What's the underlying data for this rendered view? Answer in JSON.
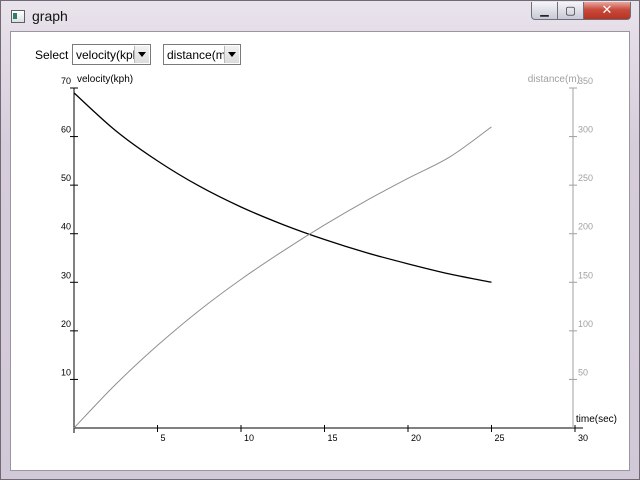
{
  "window": {
    "title": "graph"
  },
  "controls": {
    "select_label": "Select",
    "y_axis_select": {
      "value": "velocity(kph)"
    },
    "y2_axis_select": {
      "value": "distance(m)"
    }
  },
  "colors": {
    "velocity_line": "#000000",
    "distance_line": "#8f8f8f",
    "right_axis": "#a0a0a0"
  },
  "chart_data": {
    "type": "line",
    "xlabel": "time(sec)",
    "ylabel": "velocity(kph)",
    "y2label": "distance(m)",
    "xlim": [
      0,
      30
    ],
    "ylim": [
      0,
      70
    ],
    "y2lim": [
      0,
      350
    ],
    "x_ticks": [
      5,
      10,
      15,
      20,
      25,
      30
    ],
    "y_ticks": [
      10,
      20,
      30,
      40,
      50,
      60,
      70
    ],
    "y2_ticks": [
      50,
      100,
      150,
      200,
      250,
      300,
      350
    ],
    "grid": false,
    "series": [
      {
        "name": "velocity(kph)",
        "axis": "left",
        "x": [
          0,
          2.5,
          5,
          7.5,
          10,
          12.5,
          15,
          17.5,
          20,
          22.5,
          25
        ],
        "y": [
          69,
          61.2,
          55,
          49.8,
          45.5,
          41.9,
          38.8,
          36.1,
          33.8,
          31.7,
          30
        ]
      },
      {
        "name": "distance(m)",
        "axis": "right",
        "x": [
          0,
          2.5,
          5,
          7.5,
          10,
          12.5,
          15,
          17.5,
          20,
          22.5,
          25
        ],
        "y": [
          0,
          45,
          85,
          121,
          153,
          182,
          209,
          234,
          257,
          279,
          310
        ]
      }
    ]
  }
}
